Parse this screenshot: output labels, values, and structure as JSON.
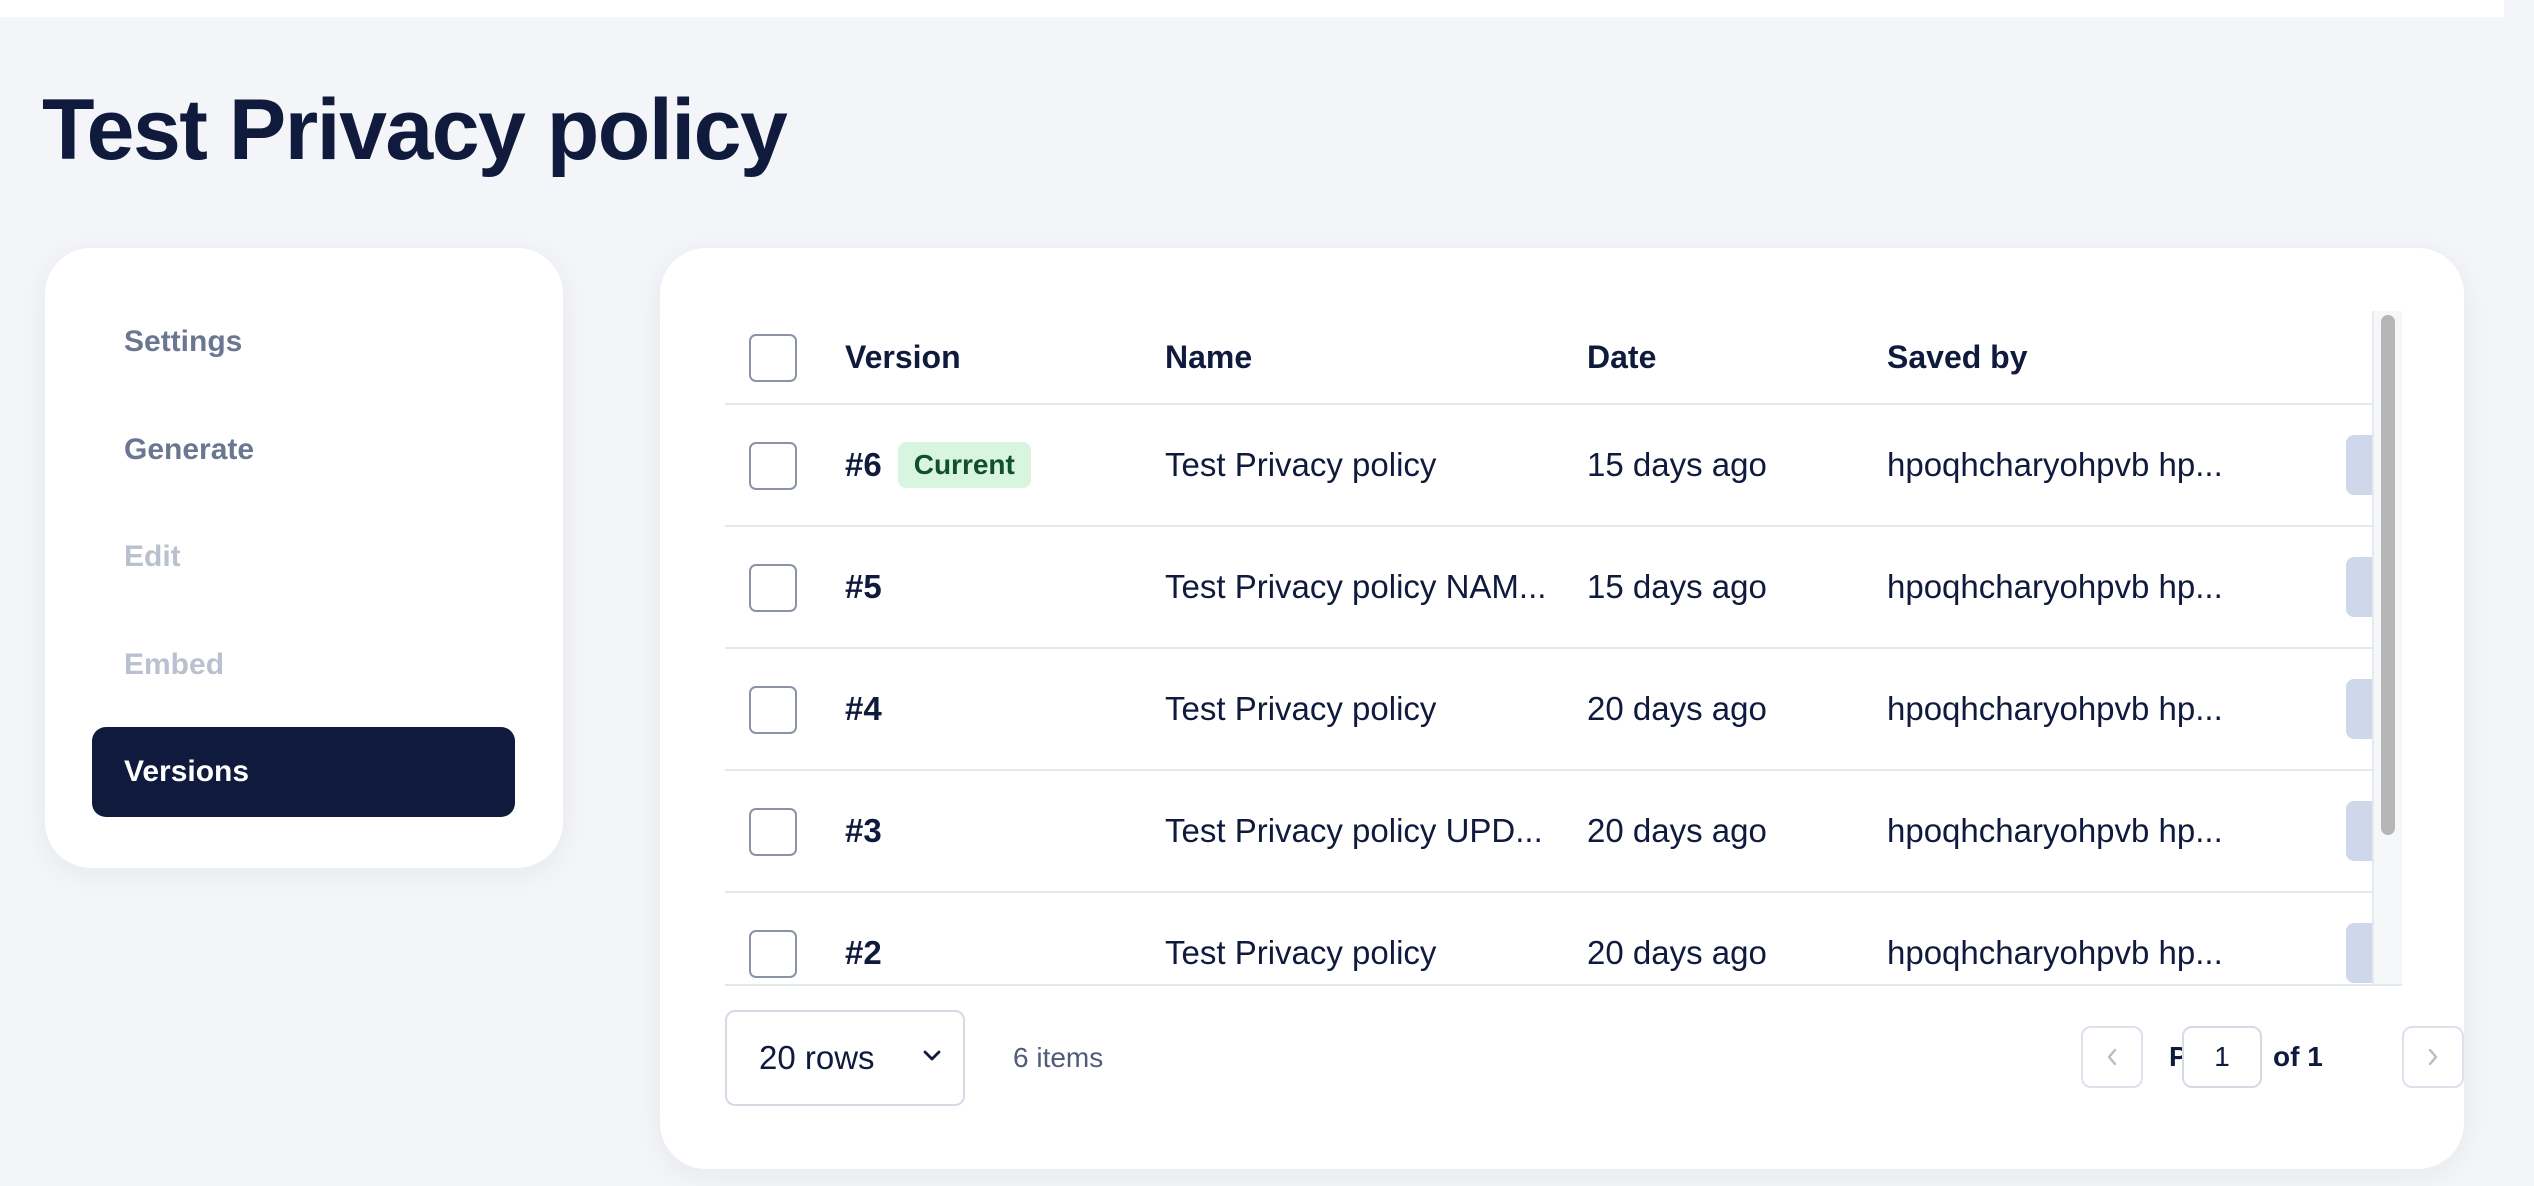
{
  "page": {
    "title": "Test Privacy policy"
  },
  "sidebar": {
    "items": [
      {
        "label": "Settings",
        "state": "normal"
      },
      {
        "label": "Generate",
        "state": "normal"
      },
      {
        "label": "Edit",
        "state": "disabled"
      },
      {
        "label": "Embed",
        "state": "disabled"
      },
      {
        "label": "Versions",
        "state": "active"
      }
    ]
  },
  "table": {
    "columns": {
      "version": "Version",
      "name": "Name",
      "date": "Date",
      "saved_by": "Saved by"
    },
    "rows": [
      {
        "version": "#6",
        "badge": "Current",
        "name": "Test Privacy policy",
        "date": "15 days ago",
        "saved_by": "hpoqhcharyohpvb hp..."
      },
      {
        "version": "#5",
        "badge": "",
        "name": "Test Privacy policy NAM...",
        "date": "15 days ago",
        "saved_by": "hpoqhcharyohpvb hp..."
      },
      {
        "version": "#4",
        "badge": "",
        "name": "Test Privacy policy",
        "date": "20 days ago",
        "saved_by": "hpoqhcharyohpvb hp..."
      },
      {
        "version": "#3",
        "badge": "",
        "name": "Test Privacy policy UPD...",
        "date": "20 days ago",
        "saved_by": "hpoqhcharyohpvb hp..."
      },
      {
        "version": "#2",
        "badge": "",
        "name": "Test Privacy policy",
        "date": "20 days ago",
        "saved_by": "hpoqhcharyohpvb hp..."
      }
    ]
  },
  "footer": {
    "rows_per_page": "20 rows",
    "items_count": "6 items",
    "page_label": "Page",
    "page_value": "1",
    "of_label": "of 1"
  },
  "icons": {
    "row_menu": "kebab-menu-icon",
    "select_chevron": "chevron-down-icon",
    "prev": "chevron-left-icon",
    "next": "chevron-right-icon"
  },
  "colors": {
    "primary": "#0f1a3d",
    "badge_bg": "#d8f6df",
    "badge_text": "#12502a",
    "kebab_bg": "#cfd8ea"
  }
}
